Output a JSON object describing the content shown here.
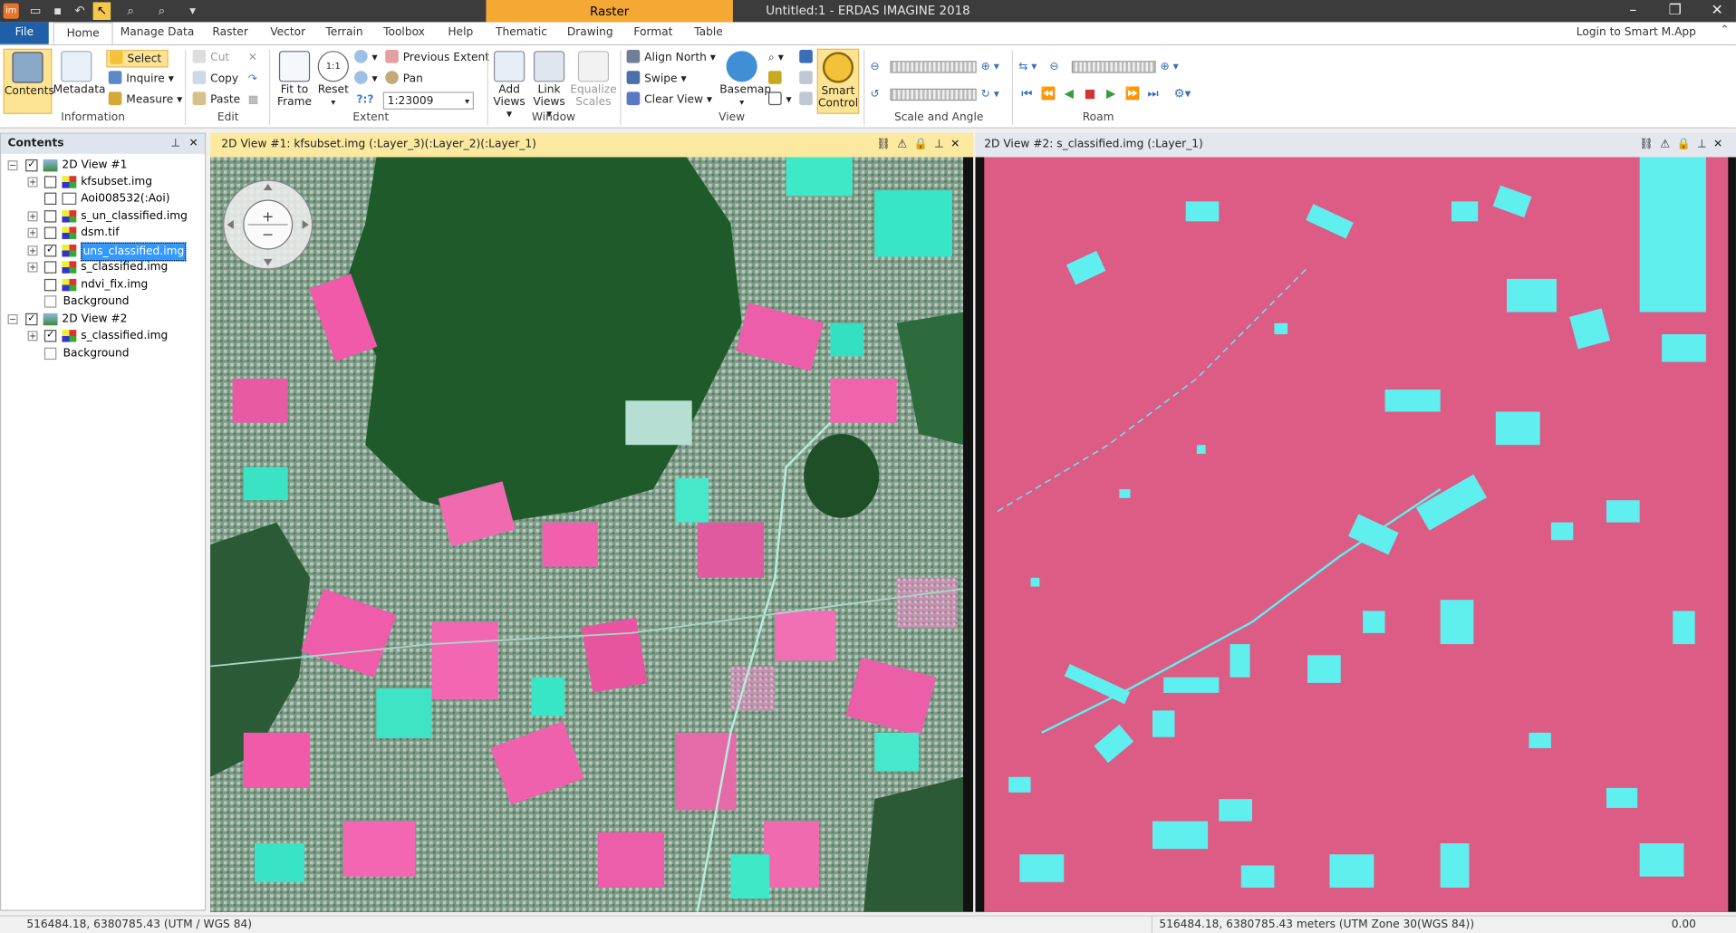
{
  "titlebar": {
    "title": "Untitled:1 - ERDAS IMAGINE 2018",
    "context_tab": "Raster"
  },
  "tabs": [
    {
      "label": "File"
    },
    {
      "label": "Home"
    },
    {
      "label": "Manage Data"
    },
    {
      "label": "Raster"
    },
    {
      "label": "Vector"
    },
    {
      "label": "Terrain"
    },
    {
      "label": "Toolbox"
    },
    {
      "label": "Help"
    },
    {
      "label": "Thematic"
    },
    {
      "label": "Drawing"
    },
    {
      "label": "Format"
    },
    {
      "label": "Table"
    }
  ],
  "login": "Login to Smart M.App",
  "ribbon": {
    "information": {
      "label": "Information",
      "contents": "Contents",
      "metadata": "Metadata"
    },
    "select": "Select",
    "inquire": "Inquire",
    "measure": "Measure",
    "edit": {
      "label": "Edit",
      "cut": "Cut",
      "copy": "Copy",
      "paste": "Paste"
    },
    "extent": {
      "label": "Extent",
      "fit_line1": "Fit to",
      "fit_line2": "Frame",
      "reset": "Reset",
      "previous_extent": "Previous Extent",
      "pan": "Pan",
      "scale": "1:23009"
    },
    "window": {
      "label": "Window",
      "add_views_line1": "Add",
      "add_views_line2": "Views",
      "link_views_line1": "Link",
      "link_views_line2": "Views",
      "equalize_line1": "Equalize",
      "equalize_line2": "Scales"
    },
    "align_north": "Align North",
    "swipe": "Swipe",
    "clear_view": "Clear View",
    "view": {
      "label": "View",
      "basemap": "Basemap",
      "smart_line1": "Smart",
      "smart_line2": "Control"
    },
    "scale_angle": {
      "label": "Scale and Angle"
    },
    "roam": {
      "label": "Roam"
    }
  },
  "contents": {
    "title": "Contents",
    "view1": {
      "label": "2D View #1",
      "layers": [
        "kfsubset.img",
        "Aoi008532(:Aoi)",
        "s_un_classified.img",
        "dsm.tif",
        "uns_classified.img",
        "s_classified.img",
        "ndvi_fix.img",
        "Background"
      ]
    },
    "view2": {
      "label": "2D View #2",
      "layers": [
        "s_classified.img",
        "Background"
      ]
    }
  },
  "view1": {
    "title": "2D View #1: kfsubset.img (:Layer_3)(:Layer_2)(:Layer_1)"
  },
  "view2": {
    "title": "2D View #2: s_classified.img (:Layer_1)"
  },
  "status": {
    "left": "516484.18, 6380785.43   (UTM / WGS 84)",
    "right": "516484.18, 6380785.43 meters (UTM Zone 30(WGS 84))",
    "zoom": "0.00"
  },
  "colors": {
    "file_tab": "#1f5fa8",
    "context_tab": "#f5a833",
    "classified_bg": "#dc5c85",
    "classified_fg": "#5fefef",
    "forest": "#1f5a2a",
    "field_pink": "#f05aa8"
  }
}
